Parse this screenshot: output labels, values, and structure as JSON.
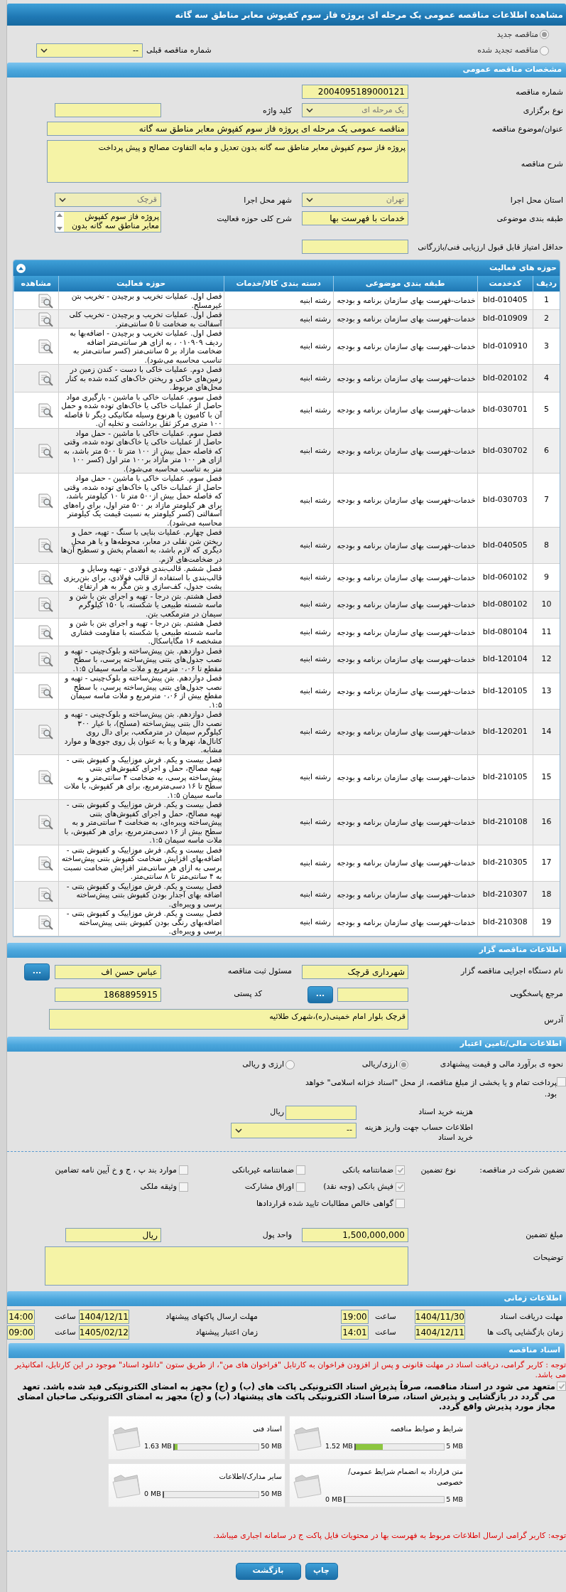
{
  "title": "مشاهده اطلاعات مناقصه عمومی یک مرحله ای پروژه فاز سوم کفپوش معابر مناطق سه گانه",
  "tender_type": [
    {
      "label": "مناقصه جدید",
      "selected": true
    },
    {
      "label": "مناقصه تجدید شده",
      "selected": false
    }
  ],
  "previous_tender": {
    "label": "شماره مناقصه قبلی",
    "kind": "select",
    "value": "--"
  },
  "general": {
    "header": "مشخصات مناقصه عمومی",
    "number": {
      "label": "شماره مناقصه",
      "kind": "input",
      "value": "2004095189000121"
    },
    "holding_type": {
      "label": "نوع برگزاری",
      "kind": "select",
      "value": "یک مرحله ای",
      "disabled": true
    },
    "keyword": {
      "label": "کلید واژه",
      "kind": "input"
    },
    "subject": {
      "label": "عنوان/موضوع مناقصه",
      "kind": "input",
      "value": "مناقصه عمومی یک مرحله ای پروژه فاز سوم کفپوش معابر مناطق سه گانه"
    },
    "description": {
      "label": "شرح مناقصه",
      "kind": "textarea",
      "value": "پروژه فاز سوم کفپوش معابر مناطق سه گانه بدون تعدیل و مابه التفاوت مصالح و پیش پرداخت"
    },
    "province": {
      "label": "استان محل اجرا",
      "kind": "select",
      "value": "تهران",
      "disabled": true
    },
    "city": {
      "label": "شهر محل اجرا",
      "kind": "select",
      "value": "قرچک",
      "disabled": true
    },
    "category": {
      "label": "طبقه بندی موضوعی",
      "kind": "input",
      "value": "خدمات با فهرست بها"
    },
    "activity_summary": {
      "label": "شرح کلی حوزه فعالیت",
      "kind": "listbox",
      "value": "پروژه فاز سوم کفپوش معابر مناطق سه گانه بدون"
    },
    "min_score": {
      "label": "حداقل امتیاز قابل قبول ارزیابی فنی/بازرگانی",
      "kind": "input"
    }
  },
  "activities": {
    "header": "حوزه های فعالیت",
    "expanded": true,
    "columns": [
      "ردیف",
      "کدخدمت",
      "طبقه بندی موضوعی",
      "دسته بندی کالا/خدمات",
      "حوزه فعالیت",
      "مشاهده"
    ],
    "rows": [
      {
        "row": "1",
        "code": "bld-010405",
        "category": "خدمات-فهرست بهای سازمان برنامه و بودجه",
        "group": "رشته ابنیه",
        "activity": "فصل اول. عملیات تخریب و برچیدن - تخریب بتن غیرمسلح."
      },
      {
        "row": "2",
        "code": "bld-010909",
        "category": "خدمات-فهرست بهای سازمان برنامه و بودجه",
        "group": "رشته ابنیه",
        "activity": "فصل اول. عملیات تخریب و برچیدن - تخریب کلی آسفالت  به ضخامت تا ۵ سانتی‌متر."
      },
      {
        "row": "3",
        "code": "bld-010910",
        "category": "خدمات-فهرست بهای سازمان برنامه و بودجه",
        "group": "رشته ابنیه",
        "activity": "فصل اول. عملیات تخریب و برچیدن - اضافه‌بها به ردیف ۰۱۰۹۰۹ ، به ازای هر سانتی‌متر اضافه ضخامت مازاد بر ۵ سانتی‌متر (کسر سانتی‌متر به تناسب محاسبه می‌شود)."
      },
      {
        "row": "4",
        "code": "bld-020102",
        "category": "خدمات-فهرست بهای سازمان برنامه و بودجه",
        "group": "رشته ابنیه",
        "activity": "فصل دوم. عملیات خاکی با دست - کندن زمین در زمین‌های خاکی و ریختن خاک‌های کنده شده به کنار محل‌های مربوط."
      },
      {
        "row": "5",
        "code": "bld-030701",
        "category": "خدمات-فهرست بهای سازمان برنامه و بودجه",
        "group": "رشته ابنیه",
        "activity": "فصل سوم. عملیات خاکی با ماشین - بارگیری مواد حاصل از عملیات خاکی یا خاک‌های توده شده و حمل آن با کامیون یا هرنوع وسیله مکانیکی دیگر تا فاصله ۱۰۰ متری مرکز ثقل  برداشت و تخلیه آن."
      },
      {
        "row": "6",
        "code": "bld-030702",
        "category": "خدمات-فهرست بهای سازمان برنامه و بودجه",
        "group": "رشته ابنیه",
        "activity": "فصل سوم. عملیات خاکی با ماشین - حمل مواد حاصل از عملیات خاکی یا خاک‌های توده شده، وقتی که فاصله حمل بیش از ۱۰۰ متر تا ۵۰۰ متر باشد، به ازای هر ۱۰۰ متر مازاد بر۱۰۰ متر اول (کسر ۱۰۰ متر به تناسب محاسبه می‌شود)."
      },
      {
        "row": "7",
        "code": "bld-030703",
        "category": "خدمات-فهرست بهای سازمان برنامه و بودجه",
        "group": "رشته ابنیه",
        "activity": "فصل سوم. عملیات خاکی با ماشین - حمل مواد حاصل از عملیات خاکی یا خاک‌های توده شده، وقتی  که فاصله حمل بیش از۵۰۰ متر تا ۱۰ کیلومتر باشد، برای هر کیلومتر مازاد بر ۵۰۰  متر اول، برای راه‌های آسفالتی (کسر کیلومتر به نسبت قیمت یک کیلومتر محاسبه می‌شود)."
      },
      {
        "row": "8",
        "code": "bld-040505",
        "category": "خدمات-فهرست بهای سازمان برنامه و بودجه",
        "group": "رشته ابنیه",
        "activity": "فصل چهارم. عملیات بنایی با سنگ - تهیه، حمل و ریختن شن نقلی در معابر، محوطه‌ها و یا هر محل دیگری که لازم باشد، به انضمام پخش و تسطیح آن‌ها در ضخامت‌های لازم."
      },
      {
        "row": "9",
        "code": "bld-060102",
        "category": "خدمات-فهرست بهای سازمان برنامه و بودجه",
        "group": "رشته ابنیه",
        "activity": "فصل ششم. قالب‌بندی فولادی - تهیه وسایل و قالب‌بندی با استفاده از قالب فولادی، برای بتن‌ریزی پشت جدول، کف‌سازی و بتن مگر به هر ارتفاع."
      },
      {
        "row": "10",
        "code": "bld-080102",
        "category": "خدمات-فهرست بهای سازمان برنامه و بودجه",
        "group": "رشته ابنیه",
        "activity": "فصل هشتم. بتن درجا - تهیه و اجرای بتن با شن و ماسه شسته طبیعی یا شکسته، با ۱۵۰ کیلوگرم سیمان در مترمکعب بتن."
      },
      {
        "row": "11",
        "code": "bld-080104",
        "category": "خدمات-فهرست بهای سازمان برنامه و بودجه",
        "group": "رشته ابنیه",
        "activity": "فصل هشتم. بتن درجا - تهیه و اجرای بتن با شن و ماسه شسته طبیعی یا شکسته با مقاومت فشاری مشخصه ۱۶ مگاپاسکال."
      },
      {
        "row": "12",
        "code": "bld-120104",
        "category": "خدمات-فهرست بهای سازمان برنامه و بودجه",
        "group": "رشته ابنیه",
        "activity": "فصل دوازدهم. بتن پیش‌ساخته و بلوک‌چینی - تهیه و نصب جدول‌های بتنی پیش‌ساخته پرسی، با سطح مقطع تا ۰،۰۶ مترمربع و ملات ماسه سیمان ۱:۵."
      },
      {
        "row": "13",
        "code": "bld-120105",
        "category": "خدمات-فهرست بهای سازمان برنامه و بودجه",
        "group": "رشته ابنیه",
        "activity": "فصل دوازدهم. بتن پیش‌ساخته و بلوک‌چینی - تهیه و نصب جدول‌های بتنی پیش‌ساخته پرسی،  با سطح مقطع بیش از ۰،۰۶ مترمربع و ملات ماسه سیمان ۱:۵."
      },
      {
        "row": "14",
        "code": "bld-120201",
        "category": "خدمات-فهرست بهای سازمان برنامه و بودجه",
        "group": "رشته ابنیه",
        "activity": "فصل دوازدهم. بتن پیش‌ساخته و بلوک‌چینی - تهیه و نصب دال بتنی پیش‌ساخته (مسلح)، با عیار ۳۰۰ کیلوگرم سیمان در مترمکعب، برای دال روی کانال‌ها، نهرها و یا به عنوان پل روی جوی‌ها و موارد مشابه."
      },
      {
        "row": "15",
        "code": "bld-210105",
        "category": "خدمات-فهرست بهای سازمان برنامه و بودجه",
        "group": "رشته ابنیه",
        "activity": "فصل بیست و یکم. فرش موزاییک و کفپوش بتنی - تهیه مصالح، حمل و اجرای کفپوش‌های بتنی پیش‌ساخته پرسی، به ضخامت ۴ سانتی‌متر و به سطح تا ۱۶ دسی‌مترمربع، برای هر کفپوش، با ملات ماسه سیمان ۱:۵."
      },
      {
        "row": "16",
        "code": "bld-210108",
        "category": "خدمات-فهرست بهای سازمان برنامه و بودجه",
        "group": "رشته ابنیه",
        "activity": "فصل بیست و یکم. فرش موزاییک و کفپوش بتنی - تهیه مصالح، حمل و اجرای کفپوش‌های بتنی پیش‌ساخته ویبره‌ای، به ضخامت ۴ سانتی‌متر و به سطح بیش از ۱۶ دسی‌مترمربع، برای هر کفپوش، با ملات ماسه سیمان ۱:۵."
      },
      {
        "row": "17",
        "code": "bld-210305",
        "category": "خدمات-فهرست بهای سازمان برنامه و بودجه",
        "group": "رشته ابنیه",
        "activity": "فصل بیست و یکم. فرش موزاییک و کفپوش بتنی - اضافه‌بهای افزایش ضخامت کفپوش بتنی پیش‌ساخته پرسی به ازای هر سانتی‌متر افزایش ضخامت نسبت به ۴ سانتی‌متر تا ۸ سانتی‌متر."
      },
      {
        "row": "18",
        "code": "bld-210307",
        "category": "خدمات-فهرست بهای سازمان برنامه و بودجه",
        "group": "رشته ابنیه",
        "activity": "فصل بیست و یکم. فرش موزاییک و کفپوش بتنی - اضافه بهای آجدار بودن کفپوش بتنی پیش‌ساخته پرسی و ویبره‌ای."
      },
      {
        "row": "19",
        "code": "bld-210308",
        "category": "خدمات-فهرست بهای سازمان برنامه و بودجه",
        "group": "رشته ابنیه",
        "activity": "فصل بیست و یکم. فرش موزاییک و کفپوش بتنی - اضافه‌بهای رنگی بودن کفپوش بتنی پیش‌ساخته پرسی و ویبره‌ای."
      }
    ]
  },
  "organizer": {
    "header": "اطلاعات مناقصه گزار",
    "agency": {
      "label": "نام دستگاه اجرایی مناقصه گزار",
      "value": "شهرداری قرچک"
    },
    "registrar": {
      "label": "مسئول ثبت مناقصه",
      "value": "عباس حسن اف",
      "button": "..."
    },
    "reference": {
      "label": "مرجع پاسخگویی",
      "button": "..."
    },
    "postal_code": {
      "label": "کد پستی",
      "value": "1868895915"
    },
    "address": {
      "label": "آدرس",
      "value": "قرچک بلوار امام خمینی(ره)،شهرک طلائیه"
    }
  },
  "finance": {
    "header": "اطلاعات مالی/تامین اعتبار",
    "estimate_label": "نحوه ی برآورد مالی و قیمت پیشنهادی",
    "estimate_options": [
      {
        "label": "ارزی/ریالی",
        "selected": true
      },
      {
        "label": "ارزی و ریالی",
        "selected": false
      }
    ],
    "treasury": {
      "label": "پرداخت تمام و یا بخشی از مبلغ مناقصه، از محل \"اسناد خزانه اسلامی\" خواهد بود.",
      "checked": false
    },
    "fee": {
      "label": "هزینه خرید اسناد",
      "unit": "ریال"
    },
    "account": {
      "label": "اطلاعات حساب جهت واریز هزینه خرید اسناد",
      "value": "--"
    },
    "guarantee_label": "تضمین شرکت در مناقصه:",
    "guarantee_type_label": "نوع تضمین",
    "guarantees": [
      {
        "label": "ضمانتنامه بانکی",
        "checked": true
      },
      {
        "label": "ضمانتنامه غیربانکی",
        "checked": false
      },
      {
        "label": "موارد بند پ ، ج و خ آیین نامه تضامین",
        "checked": false
      },
      {
        "label": "فیش بانکی (وجه نقد)",
        "checked": true
      },
      {
        "label": "اوراق مشارکت",
        "checked": false
      },
      {
        "label": "وثیقه ملکی",
        "checked": false
      },
      {
        "label": "گواهی خالص مطالبات تایید شده قراردادها",
        "checked": false
      }
    ],
    "amount": {
      "label": "مبلغ تضمین",
      "value": "1,500,000,000"
    },
    "currency": {
      "label": "واحد پول",
      "value": "ریال"
    },
    "notes": {
      "label": "توضیحات"
    }
  },
  "timing": {
    "header": "اطلاعات زمانی",
    "rows": [
      [
        {
          "label": "مهلت دریافت اسناد",
          "date": "1404/11/30",
          "time_label": "ساعت",
          "time": "19:00"
        },
        {
          "label": "مهلت ارسال پاکتهای پیشنهاد",
          "date": "1404/12/11",
          "time_label": "ساعت",
          "time": "14:00"
        }
      ],
      [
        {
          "label": "زمان بازگشایی پاکت ها",
          "date": "1404/12/11",
          "time_label": "ساعت",
          "time": "14:01"
        },
        {
          "label": "زمان اعتبار پیشنهاد",
          "date": "1405/02/12",
          "time_label": "ساعت",
          "time": "09:00"
        }
      ]
    ]
  },
  "documents": {
    "header": "اسناد مناقصه",
    "notice": "توجه : کاربر گرامی، دریافت اسناد در مهلت قانونی و پس از افزودن فراخوان به کارتابل \"فراخوان های من\"، از طریق ستون \"دانلود اسناد\" موجود در این کارتابل، امکانپذیر می باشد.",
    "commitment": {
      "label": "متعهد می شود در اسناد مناقصه، صرفاً پذیرش اسناد الکترونیکی پاکت های (ب) و (ج) مجهز به امضای الکترونیکی قید شده باشد. تعهد می گردد در بازگشایی و پذیرش اسناد، صرفاً اسناد الکترونیکی پاکت های پیشنهاد (ب) و (ج) مجهز به امضای الکترونیکی صاحبان امضای مجاز مورد پذیرش واقع گردد.",
      "checked": true
    },
    "files": [
      {
        "title": "شرایط و ضوابط مناقصه",
        "size": "1.52 MB",
        "limit": "5 MB",
        "level": 0.304
      },
      {
        "title": "اسناد فنی",
        "size": "1.63 MB",
        "limit": "50 MB",
        "level": 0.033
      },
      {
        "title": "متن قرارداد به انضمام شرایط عمومی/خصوصی",
        "size": "0 MB",
        "limit": "5 MB",
        "level": 0
      },
      {
        "title": "سایر مدارک/اطلاعات",
        "size": "0 MB",
        "limit": "50 MB",
        "level": 0
      }
    ],
    "note": "توجه: کاربر گرامی ارسال اطلاعات مربوط به فهرست بها در محتویات فایل پاکت ج در سامانه اجباری میباشد."
  },
  "buttons": [
    "چاپ",
    "بازگشت"
  ]
}
